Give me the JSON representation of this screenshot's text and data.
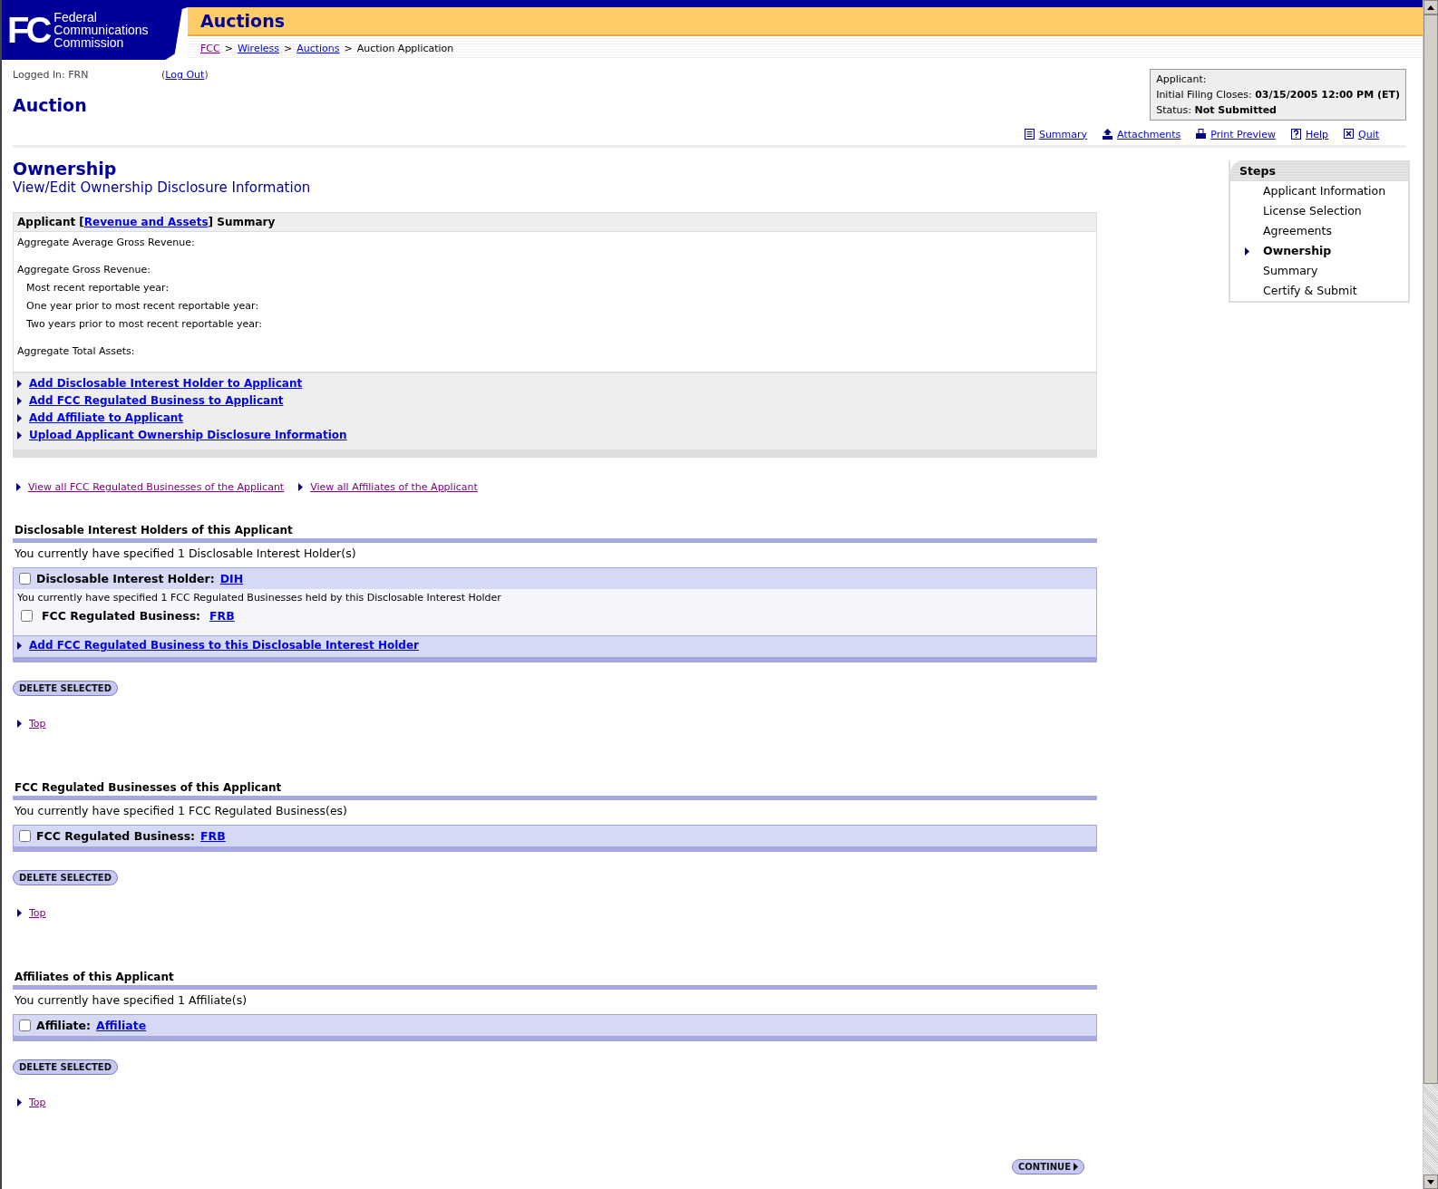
{
  "header": {
    "logo_mark": "FC",
    "logo_lines": [
      "Federal",
      "Communications",
      "Commission"
    ],
    "banner_title": "Auctions",
    "breadcrumb": [
      {
        "label": "FCC",
        "kind": "visited_link"
      },
      {
        "label": "Wireless",
        "kind": "link"
      },
      {
        "label": "Auctions",
        "kind": "link"
      },
      {
        "label": "Auction Application",
        "kind": "text"
      }
    ],
    "separator": ">"
  },
  "session": {
    "logged_in": "Logged In: FRN",
    "logout_open": "(",
    "logout": "Log Out",
    "logout_close": ")"
  },
  "page_title": "Auction",
  "info_box": [
    {
      "label": "Applicant:"
    },
    {
      "label": "Initial Filing Closes:",
      "value": "03/15/2005 12:00 PM (ET)"
    },
    {
      "label": "Status:",
      "value": "Not Submitted"
    }
  ],
  "toolbar": [
    {
      "label": "Summary"
    },
    {
      "label": "Attachments"
    },
    {
      "label": "Print Preview"
    },
    {
      "label": "Help"
    },
    {
      "label": "Quit"
    }
  ],
  "section_title": "Ownership",
  "section_subtitle": "View/Edit Ownership Disclosure Information",
  "summary": {
    "title_before": "Applicant [",
    "title_link": "Revenue and Assets",
    "title_after": "] Summary",
    "rows": [
      {
        "label": "Aggregate Average Gross Revenue:"
      },
      {
        "label": "Aggregate Gross Revenue:",
        "children": [
          {
            "label": "Most recent reportable year:"
          },
          {
            "label": "One year prior to most recent reportable year:"
          },
          {
            "label": "Two years prior to most recent reportable year:"
          }
        ]
      },
      {
        "label": "Aggregate Total Assets:"
      }
    ],
    "actions": [
      "Add Disclosable Interest Holder to Applicant",
      "Add FCC Regulated Business to Applicant",
      "Add Affiliate to Applicant",
      "Upload Applicant Ownership Disclosure Information"
    ]
  },
  "view_links": [
    "View all FCC Regulated Businesses of the Applicant",
    "View all Affiliates of the Applicant"
  ],
  "groups": [
    {
      "title": "Disclosable Interest Holders of this Applicant",
      "count_text": "You currently have specified 1 Disclosable Interest Holder(s)",
      "entries": [
        {
          "kind": "holder",
          "label": "Disclosable Interest Holder:",
          "link": "DIH",
          "checked": false,
          "sub_text": "You currently have specified 1 FCC Regulated Businesses held by this Disclosable Interest Holder",
          "children": [
            {
              "label": "FCC Regulated Business:",
              "link": "FRB",
              "checked": false
            }
          ],
          "add_link": "Add FCC Regulated Business to this Disclosable Interest Holder"
        }
      ],
      "button": "DELETE SELECTED",
      "top_link": "Top"
    },
    {
      "title": "FCC Regulated Businesses of this Applicant",
      "count_text": "You currently have specified 1 FCC Regulated Business(es)",
      "entries": [
        {
          "kind": "simple",
          "label": "FCC Regulated Business:",
          "link": "FRB",
          "checked": false
        }
      ],
      "button": "DELETE SELECTED",
      "top_link": "Top"
    },
    {
      "title": "Affiliates of this Applicant",
      "count_text": "You currently have specified 1 Affiliate(s)",
      "entries": [
        {
          "kind": "simple",
          "label": "Affiliate:",
          "link": "Affiliate",
          "checked": false
        }
      ],
      "button": "DELETE SELECTED",
      "top_link": "Top"
    }
  ],
  "continue_button": "CONTINUE",
  "steps": {
    "title": "Steps",
    "items": [
      {
        "label": "Applicant Information",
        "selected": false
      },
      {
        "label": "License Selection",
        "selected": false
      },
      {
        "label": "Agreements",
        "selected": false
      },
      {
        "label": "Ownership",
        "selected": true
      },
      {
        "label": "Summary",
        "selected": false
      },
      {
        "label": "Certify & Submit",
        "selected": false
      }
    ]
  }
}
